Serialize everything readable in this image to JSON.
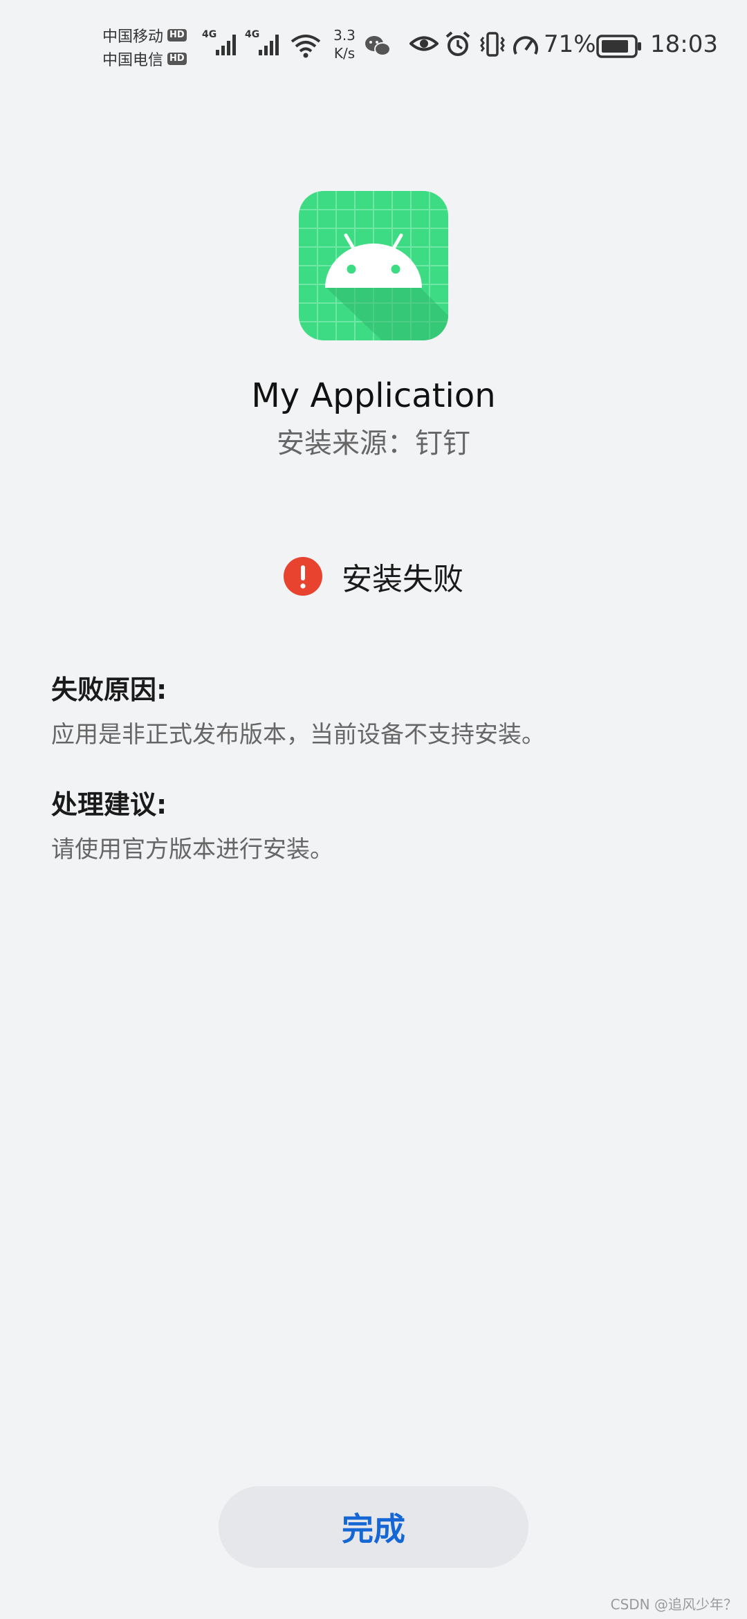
{
  "status_bar": {
    "carrier_1": "中国移动",
    "carrier_2": "中国电信",
    "hd_label": "HD",
    "network_type": "4G",
    "net_speed_value": "3.3",
    "net_speed_unit": "K/s",
    "battery_percent": "71%",
    "time": "18:03",
    "icons": [
      "signal-icon",
      "wifi-icon",
      "wechat-icon",
      "eye-icon",
      "alarm-icon",
      "vibrate-icon",
      "speedometer-icon",
      "battery-icon"
    ]
  },
  "app": {
    "name": "My Application",
    "source": "安装来源：钉钉",
    "icon": "android-app-icon",
    "icon_color": "#3ddc84"
  },
  "result": {
    "status_text": "安装失败",
    "icon": "error-icon",
    "icon_color": "#e8432e"
  },
  "details": {
    "reason_title": "失败原因:",
    "reason_text": "应用是非正式发布版本，当前设备不支持安装。",
    "suggestion_title": "处理建议:",
    "suggestion_text": "请使用官方版本进行安装。"
  },
  "actions": {
    "done_label": "完成",
    "done_color": "#1667d6"
  },
  "watermark": "CSDN @追风少年？"
}
